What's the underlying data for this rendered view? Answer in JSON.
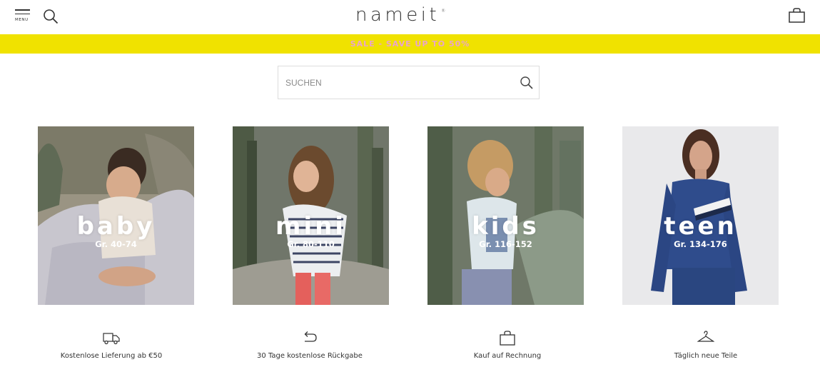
{
  "header": {
    "menu_label": "MENU",
    "logo_text": "nameit",
    "logo_mark": "®",
    "icons": [
      "hamburger-menu-icon",
      "search-icon",
      "shopping-bag-icon"
    ]
  },
  "promo": {
    "text": "SALE - SAVE UP TO 50%",
    "bg_color": "#f0e200",
    "text_color": "#e9a6c9"
  },
  "search": {
    "placeholder": "SUCHEN"
  },
  "categories": [
    {
      "label": "baby",
      "sizes": "Gr. 40-74"
    },
    {
      "label": "mini",
      "sizes": "Gr. 80-110"
    },
    {
      "label": "kids",
      "sizes": "Gr. 116-152"
    },
    {
      "label": "teen",
      "sizes": "Gr. 134-176"
    }
  ],
  "features": [
    {
      "icon": "delivery-truck-icon",
      "text": "Kostenlose Lieferung ab €50"
    },
    {
      "icon": "return-arrow-icon",
      "text": "30 Tage kostenlose Rückgabe"
    },
    {
      "icon": "shopping-bag-icon",
      "text": "Kauf auf Rechnung"
    },
    {
      "icon": "hanger-icon",
      "text": "Täglich neue Teile"
    }
  ]
}
